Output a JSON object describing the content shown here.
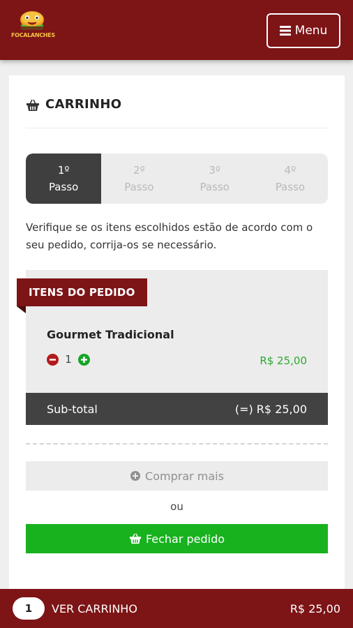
{
  "header": {
    "logo_text": "FOCALANCHES",
    "menu_label": "Menu"
  },
  "cart": {
    "title": "CARRINHO",
    "steps": [
      {
        "number": "1º",
        "label": "Passo"
      },
      {
        "number": "2º",
        "label": "Passo"
      },
      {
        "number": "3º",
        "label": "Passo"
      },
      {
        "number": "4º",
        "label": "Passo"
      }
    ],
    "active_step": 1,
    "intro": "Verifique se os itens escolhidos estão de acordo com o seu pedido, corrija-os se necessário.",
    "order_section_title": "ITENS DO PEDIDO",
    "items": [
      {
        "name": "Gourmet Tradicional",
        "quantity": "1",
        "price": "R$ 25,00"
      }
    ],
    "subtotal_label": "Sub-total",
    "subtotal_value": "(=) R$ 25,00",
    "buy_more_label": "Comprar mais",
    "or_label": "ou",
    "checkout_label": "Fechar pedido"
  },
  "bottom_bar": {
    "count": "1",
    "label": "VER CARRINHO",
    "total": "R$ 25,00"
  },
  "colors": {
    "brand": "#7d1416",
    "success": "#18b21f",
    "price": "#2ca832",
    "danger": "#b31b1b"
  },
  "icons": [
    "hamburger-logo-icon",
    "bars-icon",
    "basket-icon",
    "minus-circle-icon",
    "plus-circle-icon"
  ]
}
